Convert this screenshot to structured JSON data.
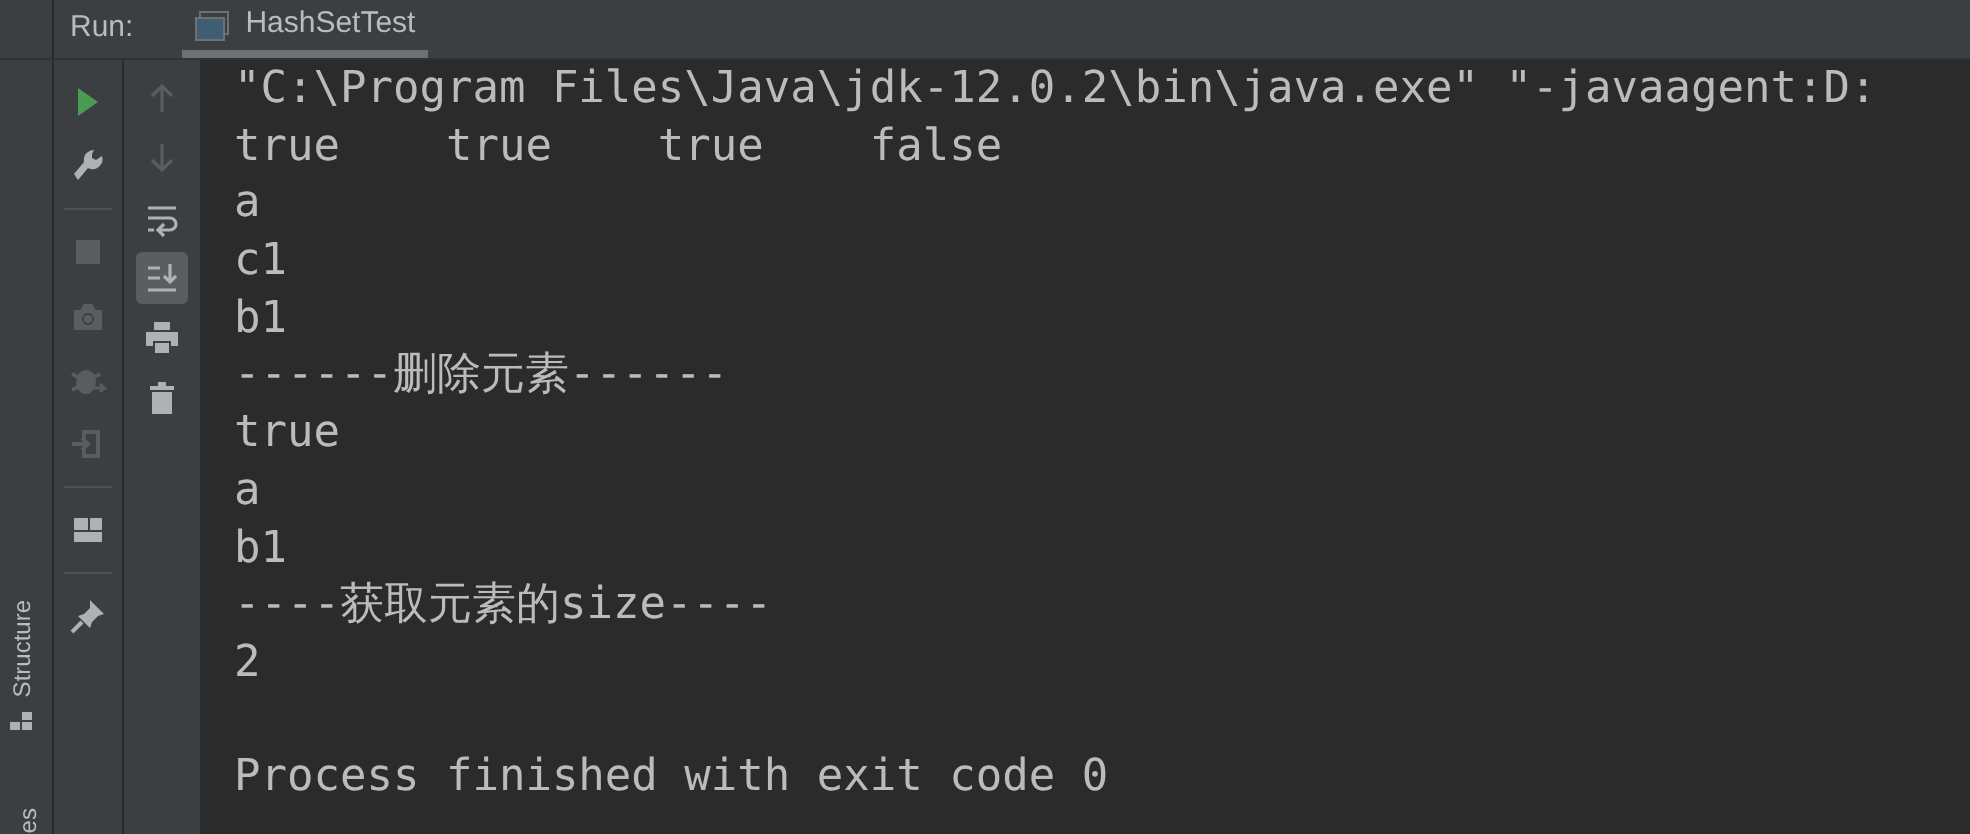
{
  "run_panel": {
    "label": "Run:",
    "tab": {
      "title": "HashSetTest",
      "selected": true
    }
  },
  "side_strip": {
    "labels": [
      "Structure",
      "es"
    ]
  },
  "toolbar_left": [
    {
      "kind": "run",
      "disabled": false
    },
    {
      "kind": "wrench",
      "disabled": false
    },
    {
      "kind": "separator"
    },
    {
      "kind": "stop",
      "disabled": true
    },
    {
      "kind": "camera",
      "disabled": true
    },
    {
      "kind": "bug",
      "disabled": true
    },
    {
      "kind": "exit",
      "disabled": true
    },
    {
      "kind": "separator"
    },
    {
      "kind": "layout",
      "disabled": false
    },
    {
      "kind": "separator"
    },
    {
      "kind": "pin",
      "disabled": false
    }
  ],
  "toolbar_right": [
    {
      "kind": "up",
      "disabled": true,
      "selected": false
    },
    {
      "kind": "down",
      "disabled": true,
      "selected": false
    },
    {
      "kind": "wrap",
      "disabled": false,
      "selected": false
    },
    {
      "kind": "scroll-end",
      "disabled": false,
      "selected": true
    },
    {
      "kind": "print",
      "disabled": false,
      "selected": false
    },
    {
      "kind": "trash",
      "disabled": false,
      "selected": false
    }
  ],
  "console": {
    "lines": [
      "\"C:\\Program Files\\Java\\jdk-12.0.2\\bin\\java.exe\" \"-javaagent:D:",
      "true    true    true    false",
      "a",
      "c1",
      "b1",
      "------删除元素------",
      "true",
      "a",
      "b1",
      "----获取元素的size----",
      "2"
    ],
    "exit_message": "Process finished with exit code 0"
  }
}
